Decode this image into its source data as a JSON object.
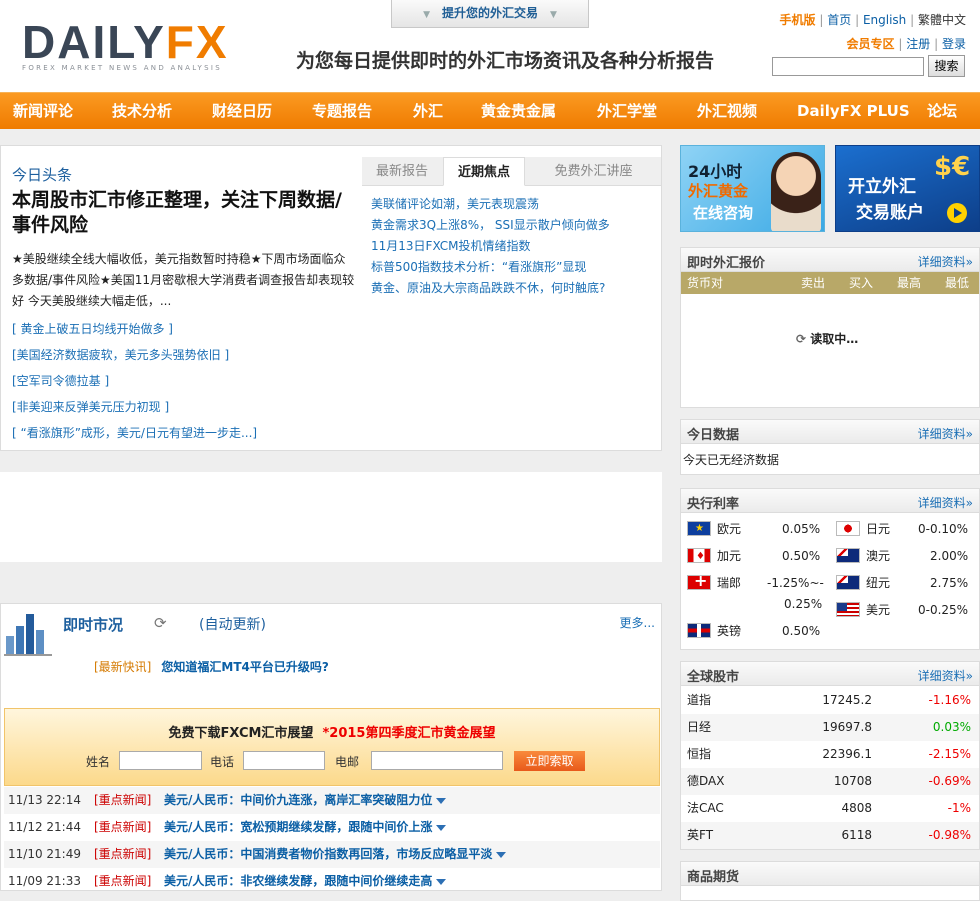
{
  "header": {
    "logo_main_a": "DAILY",
    "logo_main_b": "FX",
    "logo_sub": "FOREX MARKET NEWS AND ANALYSIS",
    "slogan": "为您每日提供即时的外汇市场资讯及各种分析报告",
    "top_button": "提升您的外汇交易",
    "links": {
      "mobile": "手机版",
      "home": "首页",
      "english": "English",
      "trad": "繁體中文"
    },
    "member": {
      "zone": "会员专区",
      "register": "注册",
      "login": "登录"
    },
    "search_button": "搜索",
    "search_value": ""
  },
  "nav": [
    "新闻评论",
    "技术分析",
    "财经日历",
    "专题报告",
    "外汇",
    "黄金贵金属",
    "外汇学堂",
    "外汇视频",
    "DailyFX PLUS",
    "论坛"
  ],
  "headline": {
    "label": "今日头条",
    "title": "本周股市汇市修正整理，关注下周数据/事件风险",
    "desc": "★美股继续全线大幅收低，美元指数暂时持稳★下周市场面临众多数据/事件风险★美国11月密歇根大学消费者调查报告却表现较好 今天美股继续大幅走低，...",
    "links": [
      "[ 黄金上破五日均线开始做多 ]",
      "[美国经济数据疲软，美元多头强势依旧 ]",
      "[空军司令德拉基 ]",
      "[非美迎来反弹美元压力初现 ]",
      "[ “看涨旗形”成形，美元/日元有望进一步走...]"
    ]
  },
  "tabs": {
    "items": [
      "最新报告",
      "近期焦点",
      "免费外汇讲座"
    ],
    "active": 1,
    "links": [
      "美联储评论如潮，美元表现震荡",
      "黄金需求3Q上涨8%， SSI显示散户倾向做多",
      "11月13日FXCM投机情绪指数",
      "标普500指数技术分析：“看涨旗形”显现",
      "黄金、原油及大宗商品跌跌不休，何时触底?"
    ]
  },
  "market": {
    "title": "即时市况",
    "auto": "(自动更新)",
    "more": "更多...",
    "flash_tag": "[最新快讯]",
    "flash_text": "您知道福汇MT4平台已升级吗?",
    "promo_title": "免费下载FXCM汇市展望",
    "promo_red": "*2015第四季度汇市黄金展望",
    "promo_fields": [
      "姓名",
      "电话",
      "电邮"
    ],
    "promo_button": "立即索取",
    "news": [
      {
        "date": "11/13  22:14",
        "tag": "[重点新闻]",
        "title": "美元/人民币：中间价九连涨，离岸汇率突破阻力位"
      },
      {
        "date": "11/12  21:44",
        "tag": "[重点新闻]",
        "title": "美元/人民币：宽松预期继续发酵，跟随中间价上涨"
      },
      {
        "date": "11/10  21:49",
        "tag": "[重点新闻]",
        "title": "美元/人民币：中国消费者物价指数再回落，市场反应略显平淡"
      },
      {
        "date": "11/09  21:33",
        "tag": "[重点新闻]",
        "title": "美元/人民币：非农继续发酵，跟随中间价继续走高"
      }
    ]
  },
  "banners": {
    "b1": [
      "24小时",
      "外汇黄金",
      "在线咨询"
    ],
    "b2": [
      "开立外汇",
      "交易账户"
    ]
  },
  "quotes": {
    "title": "即时外汇报价",
    "more": "详细资料»",
    "cols": [
      "货币对",
      "卖出",
      "买入",
      "最高",
      "最低"
    ],
    "loading": "读取中…"
  },
  "today": {
    "title": "今日数据",
    "more": "详细资料»",
    "text": "今天已无经济数据"
  },
  "rates": {
    "title": "央行利率",
    "more": "详细资料»",
    "left": [
      {
        "flag": "eu",
        "name": "欧元",
        "value": "0.05%"
      },
      {
        "flag": "ca",
        "name": "加元",
        "value": "0.50%"
      },
      {
        "flag": "ch",
        "name": "瑞郎",
        "value": "-1.25%~-",
        "value2": "0.25%"
      },
      {
        "flag": "gb",
        "name": "英镑",
        "value": "0.50%"
      }
    ],
    "right": [
      {
        "flag": "jp",
        "name": "日元",
        "value": "0-0.10%"
      },
      {
        "flag": "au",
        "name": "澳元",
        "value": "2.00%"
      },
      {
        "flag": "nz",
        "name": "纽元",
        "value": "2.75%"
      },
      {
        "flag": "us",
        "name": "美元",
        "value": "0-0.25%"
      }
    ]
  },
  "stocks": {
    "title": "全球股市",
    "more": "详细资料»",
    "rows": [
      {
        "name": "道指",
        "value": "17245.2",
        "change": "-1.16%",
        "dir": "neg"
      },
      {
        "name": "日经",
        "value": "19697.8",
        "change": "0.03%",
        "dir": "pos"
      },
      {
        "name": "恒指",
        "value": "22396.1",
        "change": "-2.15%",
        "dir": "neg"
      },
      {
        "name": "德DAX",
        "value": "10708",
        "change": "-0.69%",
        "dir": "neg"
      },
      {
        "name": "法CAC",
        "value": "4808",
        "change": "-1%",
        "dir": "neg"
      },
      {
        "name": "英FT",
        "value": "6118",
        "change": "-0.98%",
        "dir": "neg"
      }
    ]
  },
  "commodities": {
    "title": "商品期货"
  }
}
